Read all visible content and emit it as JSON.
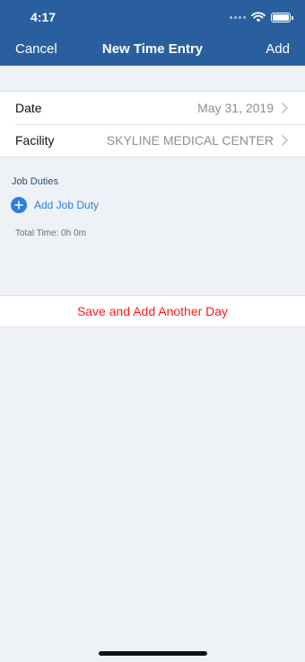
{
  "status_bar": {
    "time": "4:17",
    "signal_icon": "signal-dots-icon",
    "wifi_icon": "wifi-icon",
    "battery_icon": "battery-icon"
  },
  "nav": {
    "cancel_label": "Cancel",
    "title": "New Time Entry",
    "add_label": "Add"
  },
  "form": {
    "rows": [
      {
        "label": "Date",
        "value": "May 31, 2019"
      },
      {
        "label": "Facility",
        "value": "SKYLINE MEDICAL CENTER"
      }
    ]
  },
  "job_duties": {
    "section_title": "Job Duties",
    "add_label": "Add Job Duty",
    "total_time": "Total Time: 0h 0m"
  },
  "actions": {
    "save_another_label": "Save and Add Another Day"
  },
  "colors": {
    "nav_bar": "#2a5f9f",
    "accent_blue": "#2f7de1",
    "destructive_red": "#ff1a1a",
    "background": "#eef2f6"
  }
}
